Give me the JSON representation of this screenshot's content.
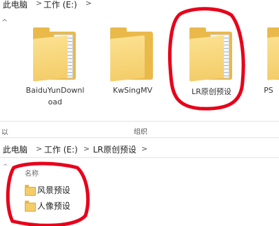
{
  "top_breadcrumb": {
    "items": [
      "此电脑",
      "工作 (E:)"
    ],
    "separator": ">"
  },
  "folders": [
    {
      "name": "BaiduYunDownload",
      "line1": "BaiduYunDownl",
      "line2": "oad"
    },
    {
      "name": "KwSingMV"
    },
    {
      "name": "LR原创预设"
    },
    {
      "name": "PS"
    }
  ],
  "ribbon": {
    "left_fragment": "以",
    "group_label": "组织"
  },
  "bottom_breadcrumb": {
    "items": [
      "此电脑",
      "工作 (E:)",
      "LR原创预设"
    ],
    "separator": ">"
  },
  "list_header": {
    "name_col": "名称"
  },
  "files": [
    {
      "name": "风景预设"
    },
    {
      "name": "人像预设"
    }
  ],
  "colors": {
    "annotation_red": "#e8001a",
    "folder_yellow": "#f4cd6a"
  }
}
